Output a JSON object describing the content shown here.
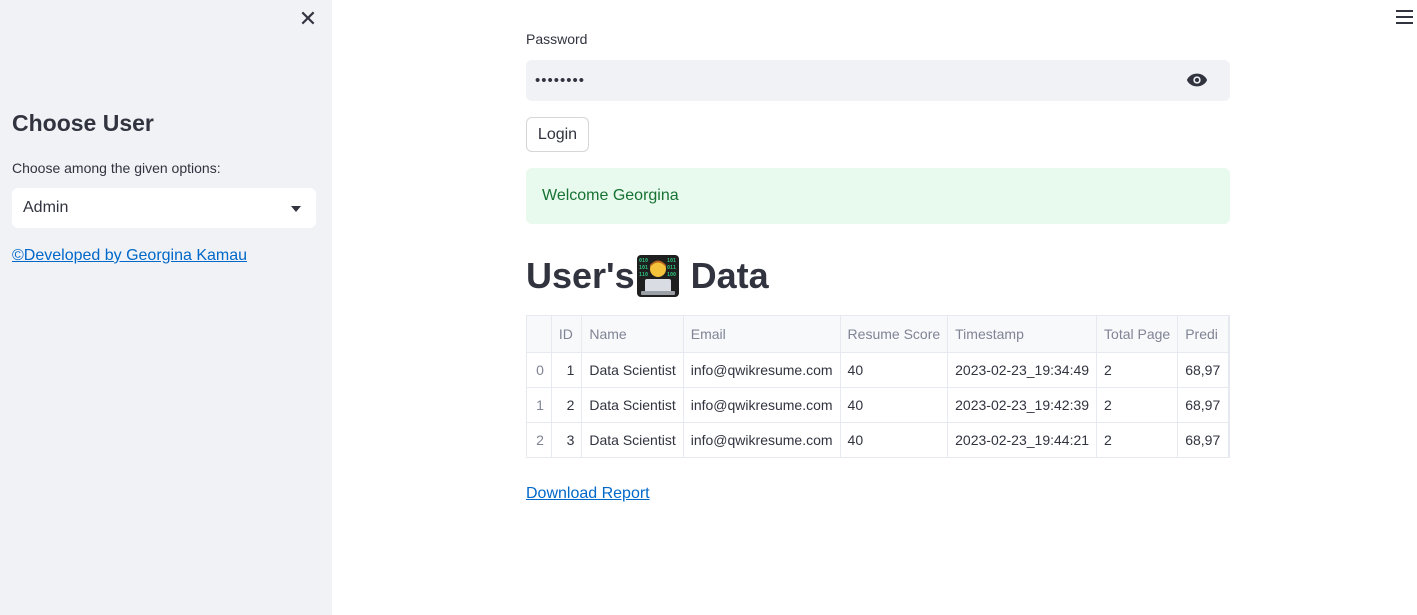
{
  "sidebar": {
    "title": "Choose User",
    "select_label": "Choose among the given options:",
    "select_value": "Admin",
    "footer_link": "©Developed by Georgina Kamau"
  },
  "main": {
    "password_label": "Password",
    "password_value": "••••••••",
    "login_label": "Login",
    "welcome_text": "Welcome Georgina",
    "heading_before": "User's",
    "heading_after": "Data",
    "download_link": "Download Report"
  },
  "table": {
    "columns": [
      "",
      "ID",
      "Name",
      "Email",
      "Resume Score",
      "Timestamp",
      "Total Page",
      "Predi"
    ],
    "rows": [
      [
        "0",
        "1",
        "Data Scientist",
        "info@qwikresume.com",
        "40",
        "2023-02-23_19:34:49",
        "2",
        "68,97"
      ],
      [
        "1",
        "2",
        "Data Scientist",
        "info@qwikresume.com",
        "40",
        "2023-02-23_19:42:39",
        "2",
        "68,97"
      ],
      [
        "2",
        "3",
        "Data Scientist",
        "info@qwikresume.com",
        "40",
        "2023-02-23_19:44:21",
        "2",
        "68,97"
      ]
    ]
  },
  "icons": {
    "close": "close-icon",
    "menu": "hamburger-menu-icon",
    "eye": "eye-icon",
    "caret": "chevron-down-icon",
    "emoji": "technologist-emoji"
  },
  "colors": {
    "sidebar_bg": "#f0f2f6",
    "link": "#0068c9",
    "success_bg": "#e8f9ee",
    "success_text": "#177233",
    "text": "#31333f"
  }
}
